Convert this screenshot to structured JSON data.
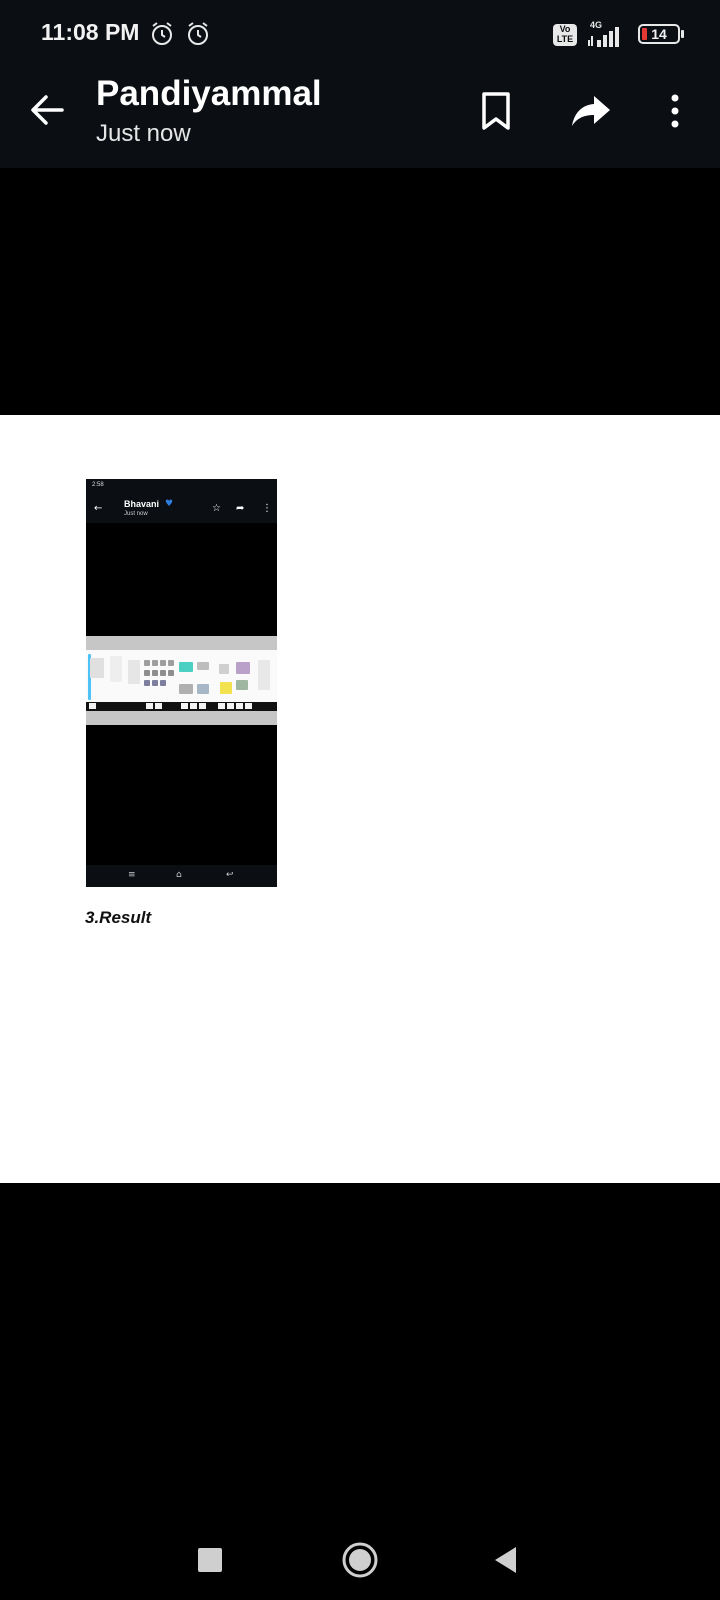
{
  "status_bar": {
    "time": "11:08 PM",
    "network_type": "4G",
    "volte_label": "Vo LTE",
    "battery_percent": "14",
    "icons": [
      "alarm-icon",
      "alarm-icon",
      "volte-icon",
      "signal-icon",
      "battery-icon"
    ]
  },
  "app_bar": {
    "title": "Pandiyammal",
    "subtitle": "Just now",
    "icons": [
      "back-arrow-icon",
      "bookmark-icon",
      "share-icon",
      "more-vert-icon"
    ]
  },
  "document": {
    "embedded_screenshot": {
      "status_time": "2:58",
      "title": "Bhavani",
      "subtitle": "Just now"
    },
    "caption": "3.Result"
  },
  "nav_bar": {
    "icons": [
      "recents-square-icon",
      "home-circle-icon",
      "back-triangle-icon"
    ]
  },
  "colors": {
    "bar_background": "#0b0f14",
    "page_background": "#000000",
    "document_background": "#ffffff",
    "battery_low": "#e53935"
  }
}
